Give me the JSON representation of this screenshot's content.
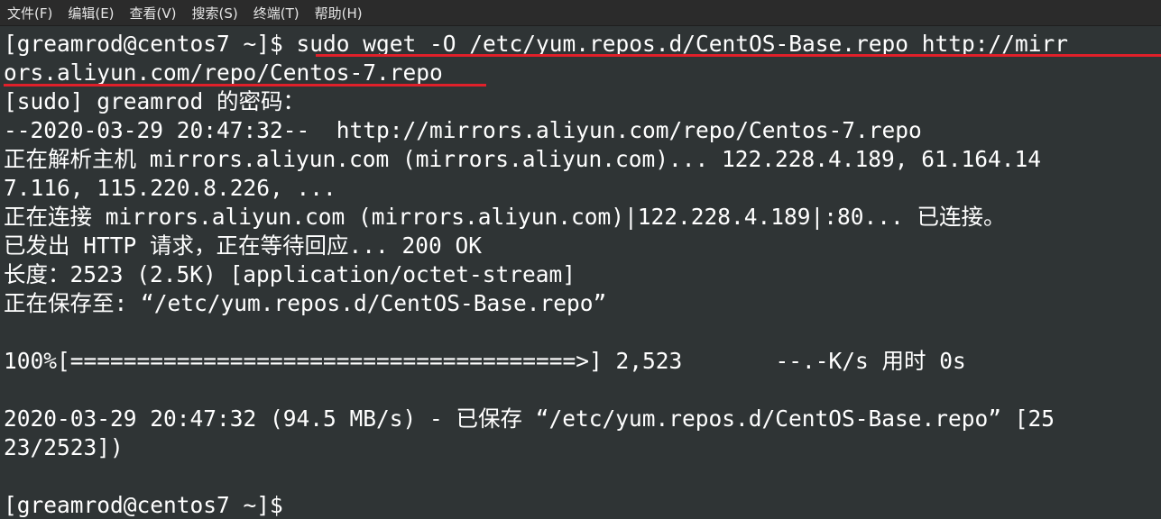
{
  "menubar": {
    "items": [
      "文件(F)",
      "编辑(E)",
      "查看(V)",
      "搜索(S)",
      "终端(T)",
      "帮助(H)"
    ]
  },
  "terminal": {
    "prompt1": "[greamrod@centos7 ~]$ ",
    "command_line1": "sudo wget -O /etc/yum.repos.d/CentOS-Base.repo http://mirr",
    "command_line2": "ors.aliyun.com/repo/Centos-7.repo",
    "lines": [
      "[sudo] greamrod 的密码：",
      "--2020-03-29 20:47:32--  http://mirrors.aliyun.com/repo/Centos-7.repo",
      "正在解析主机 mirrors.aliyun.com (mirrors.aliyun.com)... 122.228.4.189, 61.164.14",
      "7.116, 115.220.8.226, ...",
      "正在连接 mirrors.aliyun.com (mirrors.aliyun.com)|122.228.4.189|:80... 已连接。",
      "已发出 HTTP 请求，正在等待回应... 200 OK",
      "长度：2523 (2.5K) [application/octet-stream]",
      "正在保存至: “/etc/yum.repos.d/CentOS-Base.repo”",
      "",
      "100%[======================================>] 2,523       --.-K/s 用时 0s",
      "",
      "2020-03-29 20:47:32 (94.5 MB/s) - 已保存 “/etc/yum.repos.d/CentOS-Base.repo” [25",
      "23/2523])",
      "",
      "[greamrod@centos7 ~]$ "
    ]
  },
  "colors": {
    "background": "#2f3435",
    "menubar": "#2b2b2b",
    "text": "#ffffff",
    "highlight_underline": "#e0202a"
  }
}
